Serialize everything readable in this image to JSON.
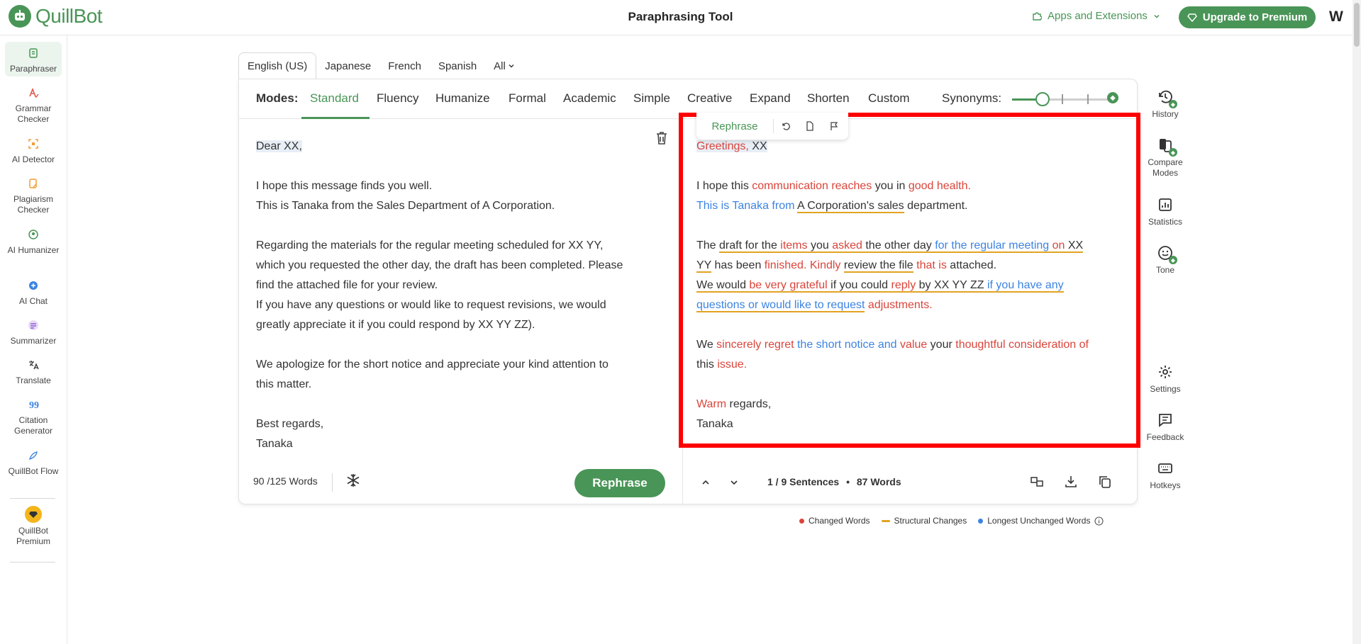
{
  "header": {
    "logo_text": "QuillBot",
    "title": "Paraphrasing Tool",
    "apps_label": "Apps and Extensions",
    "upgrade_label": "Upgrade to Premium",
    "avatar_initial": "W"
  },
  "sidebar": {
    "items": [
      {
        "label": "Paraphraser",
        "icon": "paraphraser-icon",
        "color": "#499557"
      },
      {
        "label": "Grammar Checker",
        "icon": "grammar-icon",
        "color": "#e2574c"
      },
      {
        "label": "AI Detector",
        "icon": "ai-detector-icon",
        "color": "#f39c32"
      },
      {
        "label": "Plagiarism Checker",
        "icon": "plagiarism-icon",
        "color": "#f39c32"
      },
      {
        "label": "AI Humanizer",
        "icon": "humanizer-icon",
        "color": "#499557"
      },
      {
        "label": "AI Chat",
        "icon": "ai-chat-icon",
        "color": "#3c83e2"
      },
      {
        "label": "Summarizer",
        "icon": "summarizer-icon",
        "color": "#8e5bd6"
      },
      {
        "label": "Translate",
        "icon": "translate-icon",
        "color": "#333333"
      },
      {
        "label": "Citation Generator",
        "icon": "citation-icon",
        "color": "#3c83e2"
      },
      {
        "label": "QuillBot Flow",
        "icon": "flow-icon",
        "color": "#3c83e2"
      },
      {
        "label": "QuillBot Premium",
        "icon": "premium-icon",
        "color": "#f3b51b"
      }
    ]
  },
  "languages": [
    "English (US)",
    "Japanese",
    "French",
    "Spanish",
    "All"
  ],
  "modes": {
    "label": "Modes:",
    "items": [
      "Standard",
      "Fluency",
      "Humanize",
      "Formal",
      "Academic",
      "Simple",
      "Creative",
      "Expand",
      "Shorten",
      "Custom"
    ],
    "active": "Standard",
    "synonyms_label": "Synonyms:",
    "synonyms_level": 0.3
  },
  "input": {
    "lines": [
      "Dear XX,",
      "",
      "I hope this message finds you well.",
      "This is Tanaka from the Sales Department of A Corporation.",
      "",
      "Regarding the materials for the regular meeting scheduled for XX YY,",
      "which you requested the other day, the draft has been completed. Please",
      "find the attached file for your review.",
      "If you have any questions or would like to request revisions, we would",
      "greatly appreciate it if you could respond by XX YY ZZ).",
      "",
      "We apologize for the short notice and appreciate your kind attention to",
      "this matter.",
      "",
      "Best regards,",
      "Tanaka"
    ],
    "word_count": "90 /125 Words",
    "rephrase_label": "Rephrase"
  },
  "output": {
    "toolbar_rephrase": "Rephrase",
    "lines": [
      [
        {
          "t": "Greetings,",
          "k": "c hl2"
        },
        {
          "t": " ",
          "k": "hl2"
        },
        {
          "t": "XX",
          "k": "hl2"
        }
      ],
      [],
      [
        {
          "t": "I hope this ",
          "k": ""
        },
        {
          "t": "communication reaches",
          "k": "c"
        },
        {
          "t": " you in ",
          "k": ""
        },
        {
          "t": "good health.",
          "k": "c"
        }
      ],
      [
        {
          "t": "This is Tanaka from",
          "k": "l"
        },
        {
          "t": " ",
          "k": ""
        },
        {
          "t": "A Corporation's sales",
          "k": "s"
        },
        {
          "t": " department.",
          "k": ""
        }
      ],
      [],
      [
        {
          "t": "The ",
          "k": ""
        },
        {
          "t": "draft for the ",
          "k": "s"
        },
        {
          "t": "items",
          "k": "c s"
        },
        {
          "t": " you ",
          "k": "s"
        },
        {
          "t": "asked",
          "k": "c s"
        },
        {
          "t": " the other day ",
          "k": "s"
        },
        {
          "t": "for the regular meeting",
          "k": "l s"
        },
        {
          "t": " ",
          "k": "s"
        },
        {
          "t": "on",
          "k": "c s"
        },
        {
          "t": " XX",
          "k": "s"
        }
      ],
      [
        {
          "t": "YY",
          "k": "s"
        },
        {
          "t": " has been ",
          "k": ""
        },
        {
          "t": "finished. Kindly",
          "k": "c"
        },
        {
          "t": " ",
          "k": ""
        },
        {
          "t": "review the file",
          "k": "s"
        },
        {
          "t": " ",
          "k": ""
        },
        {
          "t": "that is",
          "k": "c"
        },
        {
          "t": " attached.",
          "k": ""
        }
      ],
      [
        {
          "t": "We would ",
          "k": "s"
        },
        {
          "t": "be very grateful",
          "k": "c s"
        },
        {
          "t": " if you could ",
          "k": "s"
        },
        {
          "t": "reply",
          "k": "c s"
        },
        {
          "t": " by XX YY ZZ ",
          "k": "s"
        },
        {
          "t": "if you have any",
          "k": "l s"
        }
      ],
      [
        {
          "t": "questions or would like to request",
          "k": "l s"
        },
        {
          "t": " ",
          "k": ""
        },
        {
          "t": "adjustments.",
          "k": "c"
        }
      ],
      [],
      [
        {
          "t": "We ",
          "k": ""
        },
        {
          "t": "sincerely regret",
          "k": "c"
        },
        {
          "t": " ",
          "k": ""
        },
        {
          "t": "the short notice and",
          "k": "l"
        },
        {
          "t": " ",
          "k": ""
        },
        {
          "t": "value",
          "k": "c"
        },
        {
          "t": " your ",
          "k": ""
        },
        {
          "t": "thoughtful consideration of",
          "k": "c"
        }
      ],
      [
        {
          "t": "this ",
          "k": ""
        },
        {
          "t": "issue.",
          "k": "c"
        }
      ],
      [],
      [
        {
          "t": "Warm",
          "k": "c"
        },
        {
          "t": " regards,",
          "k": ""
        }
      ],
      [
        {
          "t": "Tanaka",
          "k": ""
        }
      ]
    ],
    "sentences": "1 / 9 Sentences",
    "bullet": "•",
    "words": "87 Words"
  },
  "legend": {
    "changed": "Changed Words",
    "structural": "Structural Changes",
    "unchanged": "Longest Unchanged Words",
    "colors": {
      "changed": "#d9453b",
      "structural": "#e2a322",
      "unchanged": "#3c83e2"
    }
  },
  "rail": {
    "items": [
      "History",
      "Compare Modes",
      "Statistics",
      "Tone",
      "Settings",
      "Feedback",
      "Hotkeys"
    ]
  }
}
